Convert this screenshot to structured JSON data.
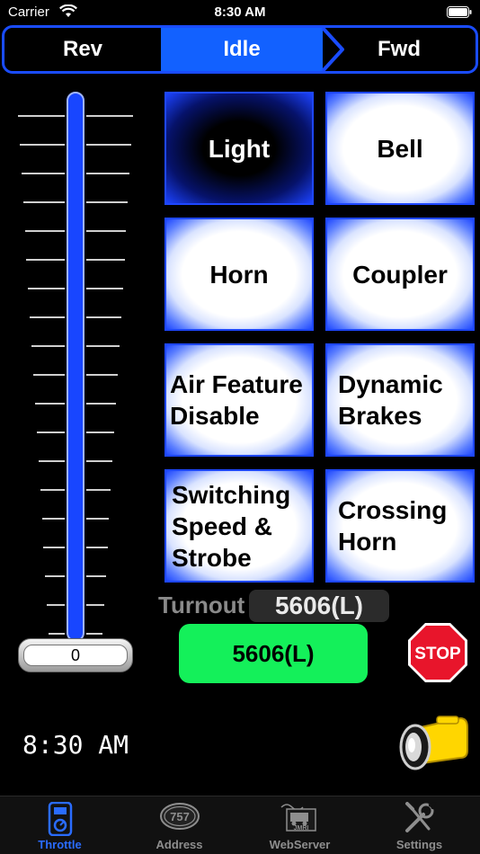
{
  "status_bar": {
    "carrier": "Carrier",
    "time": "8:30 AM"
  },
  "direction": {
    "rev": "Rev",
    "idle": "Idle",
    "fwd": "Fwd",
    "selected": "Idle"
  },
  "throttle": {
    "speed": "0",
    "level": 0
  },
  "functions": {
    "light": "Light",
    "bell": "Bell",
    "horn": "Horn",
    "coupler": "Coupler",
    "air_feature_disable": [
      "Air Feature",
      "Disable"
    ],
    "dynamic_brakes": [
      "Dynamic",
      "Brakes"
    ],
    "switching_speed": [
      "Switching",
      "Speed &",
      "Strobe"
    ],
    "crossing_horn": [
      "Crossing",
      "Horn"
    ]
  },
  "turnout": {
    "label": "Turnout",
    "value": "5606(L)"
  },
  "address_button": "5606(L)",
  "stop_label": "STOP",
  "time_readout": "8:30 AM",
  "tabs": [
    {
      "label": "Throttle",
      "icon": "throttle-icon",
      "selected": true
    },
    {
      "label": "Address",
      "icon": "address-757-icon",
      "badge": "757"
    },
    {
      "label": "WebServer",
      "icon": "jmri-webserver-icon",
      "badge": "JMRI"
    },
    {
      "label": "Settings",
      "icon": "wrench-screwdriver-icon"
    }
  ],
  "colors": {
    "accent": "#1261ff",
    "address_green": "#14f05a",
    "stop_red": "#e8152b",
    "flashlight_yellow": "#ffd600"
  }
}
